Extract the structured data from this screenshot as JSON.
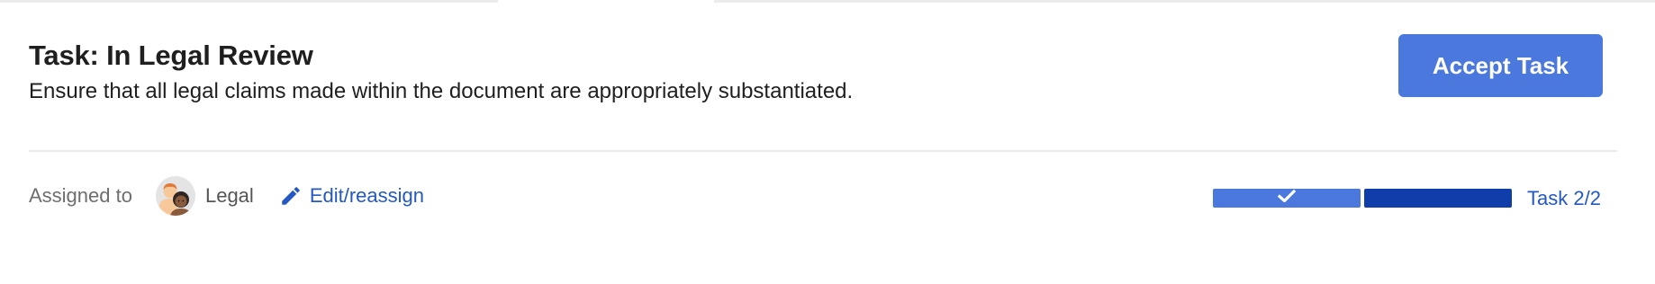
{
  "task": {
    "title": "Task: In Legal Review",
    "description": "Ensure that all legal claims made within the document are appropriately substantiated."
  },
  "actions": {
    "accept_label": "Accept Task"
  },
  "assignment": {
    "assigned_label": "Assigned to",
    "assignee_name": "Legal",
    "avatar_icon": "team-avatar-icon",
    "edit_label": "Edit/reassign",
    "edit_icon": "pencil-icon"
  },
  "progress": {
    "steps": [
      {
        "status": "completed",
        "icon": "check-icon"
      },
      {
        "status": "current"
      }
    ],
    "count_label": "Task 2/2"
  },
  "colors": {
    "accent": "#4a78dc",
    "current_step": "#0f3eab",
    "link": "#2458c3",
    "text": "#1f1f1f",
    "muted_text": "#6e6e6e"
  }
}
